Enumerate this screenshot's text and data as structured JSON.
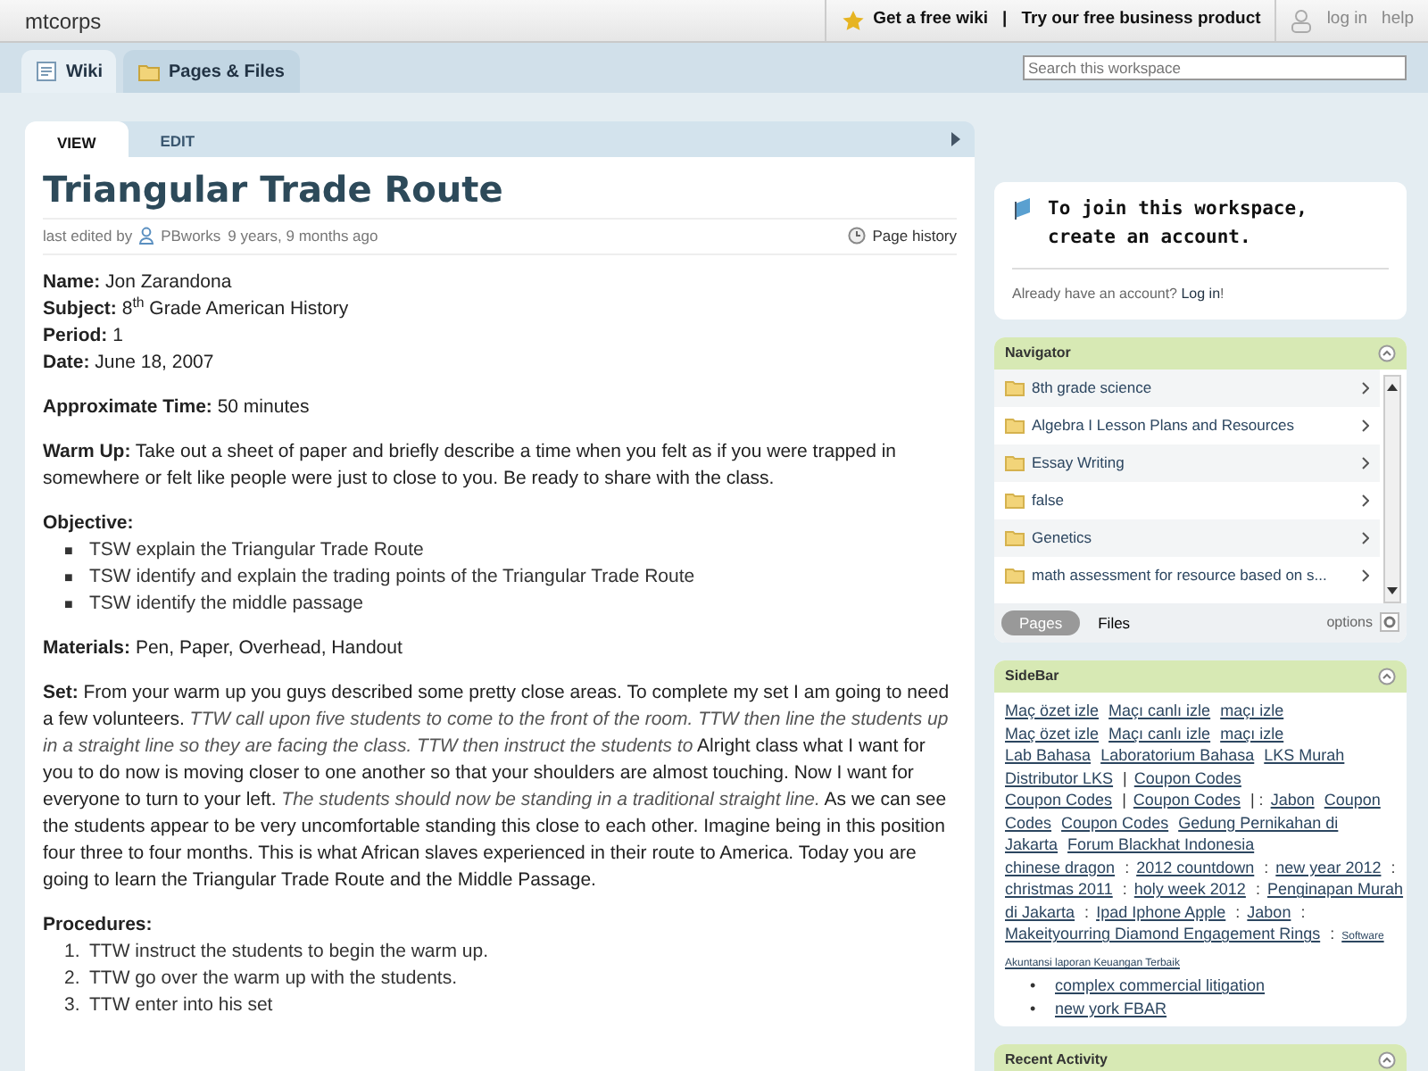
{
  "header": {
    "site": "mtcorps",
    "promo_free": "Get a free wiki",
    "promo_sep": "|",
    "promo_business": "Try our free business product",
    "login": "log in",
    "help": "help"
  },
  "tabs": [
    {
      "label": "Wiki",
      "selected": true
    },
    {
      "label": "Pages & Files",
      "selected": false
    }
  ],
  "search": {
    "placeholder": "Search this workspace"
  },
  "page_tabs": [
    {
      "label": "VIEW",
      "selected": true
    },
    {
      "label": "EDIT",
      "selected": false
    }
  ],
  "page": {
    "title": "Triangular Trade Route",
    "edited_prefix": "last edited by",
    "editor": "PBworks",
    "edited_when": "9 years, 9 months ago",
    "history": "Page history",
    "blocks": [
      {
        "kind": "lines",
        "lines": [
          "**Name:** Jon Zarandona",
          "**Subject:** 8$^{th}$ Grade American History",
          "**Period:** 1",
          "**Date:** June 18, 2007"
        ]
      },
      {
        "kind": "para",
        "text": "**Approximate Time:** 50 minutes"
      },
      {
        "kind": "para",
        "text": "**Warm Up:** Take out a sheet of paper and briefly describe a time when you felt as if you were trapped in somewhere or felt like people were just to close to you. Be ready to share with the class."
      },
      {
        "kind": "list",
        "heading": "**Objective:**",
        "items": [
          {
            "marker": "■",
            "text": "TSW explain the Triangular Trade Route"
          },
          {
            "marker": "■",
            "text": "TSW identify and explain the trading points of the Triangular Trade Route"
          },
          {
            "marker": "■",
            "text": "TSW identify the middle passage"
          }
        ]
      },
      {
        "kind": "para",
        "text": "**Materials:** Pen, Paper, Overhead, Handout"
      },
      {
        "kind": "para",
        "text": "**Set:** From your warm up you guys described some pretty close areas. To complete my set I am going to need a few volunteers. *TTW call upon five students to come to the front of the room. TTW then line the students up in a straight line so they are facing the class. TTW then instruct the students to* Alright class what I want for you to do now is moving closer to one another so that your shoulders are almost touching. Now I want for everyone to turn to your left. *The students should now be standing in a traditional straight line.* As we can see the students appear to be very uncomfortable standing this close to each other. Imagine being in this position four three to four months. This is what African slaves experienced in their route to America. Today you are going to learn the Triangular Trade Route and the Middle Passage."
      },
      {
        "kind": "list",
        "heading": "**Procedures:**",
        "items": [
          {
            "marker": "1.",
            "text": "TTW instruct the students to begin the warm up."
          },
          {
            "marker": "2.",
            "text": "TTW go over the warm up with the students."
          },
          {
            "marker": "3.",
            "text": "TTW enter into his set"
          }
        ]
      }
    ]
  },
  "join": {
    "prefix": "To join this workspace,",
    "link": "create an account",
    "suffix": ".",
    "already": "Already have an account?",
    "login": "Log in",
    "login_suffix": "!"
  },
  "navigator": {
    "title": "Navigator",
    "items": [
      "8th grade science",
      "Algebra I Lesson Plans and Resources",
      "Essay Writing",
      "false",
      "Genetics",
      "math assessment for resource based on s..."
    ],
    "tabs": [
      {
        "label": "Pages",
        "selected": true
      },
      {
        "label": "Files",
        "selected": false
      }
    ],
    "options": "options"
  },
  "sidebar": {
    "title": "SideBar",
    "lines": [
      [
        {
          "kind": "link",
          "text": "Maç özet izle"
        },
        {
          "kind": "link",
          "text": "Maçı canlı izle"
        },
        {
          "kind": "link",
          "text": "maçı izle"
        }
      ],
      [
        {
          "kind": "link",
          "text": "Maç özet izle"
        },
        {
          "kind": "link",
          "text": "Maçı canlı izle"
        },
        {
          "kind": "link",
          "text": "maçı izle"
        }
      ],
      [
        {
          "kind": "link",
          "text": "Lab Bahasa"
        },
        {
          "kind": "link",
          "text": "Laboratorium Bahasa"
        },
        {
          "kind": "link",
          "text": "LKS Murah"
        }
      ],
      [
        {
          "kind": "link",
          "text": "Distributor LKS"
        },
        {
          "kind": "text",
          "text": "|"
        },
        {
          "kind": "link",
          "text": "Coupon Codes"
        }
      ],
      [
        {
          "kind": "link",
          "text": "Coupon Codes"
        },
        {
          "kind": "text",
          "text": "|"
        },
        {
          "kind": "link",
          "text": "Coupon Codes"
        },
        {
          "kind": "text",
          "text": "| :"
        },
        {
          "kind": "link",
          "text": "Jabon"
        },
        {
          "kind": "link",
          "text": "Coupon"
        }
      ],
      [
        {
          "kind": "link",
          "text": "Codes"
        },
        {
          "kind": "link",
          "text": "Coupon Codes"
        },
        {
          "kind": "link",
          "text": "Gedung Pernikahan di"
        }
      ],
      [
        {
          "kind": "link",
          "text": "Jakarta"
        },
        {
          "kind": "link",
          "text": "Forum Blackhat Indonesia"
        }
      ],
      [
        {
          "kind": "link",
          "text": "chinese dragon"
        },
        {
          "kind": "text",
          "text": ":"
        },
        {
          "kind": "link",
          "text": "2012 countdown"
        },
        {
          "kind": "text",
          "text": ":"
        },
        {
          "kind": "link",
          "text": "new year 2012"
        },
        {
          "kind": "text",
          "text": ":"
        }
      ],
      [
        {
          "kind": "link",
          "text": "christmas 2011"
        },
        {
          "kind": "text",
          "text": ":"
        },
        {
          "kind": "link",
          "text": "holy week 2012"
        },
        {
          "kind": "text",
          "text": ":"
        },
        {
          "kind": "link",
          "text": "Penginapan Murah"
        }
      ],
      [
        {
          "kind": "link",
          "text": "di Jakarta"
        },
        {
          "kind": "text",
          "text": ":"
        },
        {
          "kind": "link",
          "text": "Ipad Iphone Apple"
        },
        {
          "kind": "text",
          "text": ":"
        },
        {
          "kind": "link",
          "text": "Jabon"
        },
        {
          "kind": "text",
          "text": ":"
        }
      ],
      [
        {
          "kind": "link",
          "text": "Makeityourring Diamond Engagement Rings"
        },
        {
          "kind": "text",
          "text": ":"
        },
        {
          "kind": "small",
          "text": "Software"
        }
      ],
      [
        {
          "kind": "small",
          "text": "Akuntansi laporan Keuangan Terbaik"
        }
      ]
    ],
    "bullets": [
      {
        "marker": "•",
        "text": "complex commercial litigation"
      },
      {
        "marker": "•",
        "text": "new york FBAR"
      }
    ]
  },
  "recent": {
    "title": "Recent Activity"
  }
}
